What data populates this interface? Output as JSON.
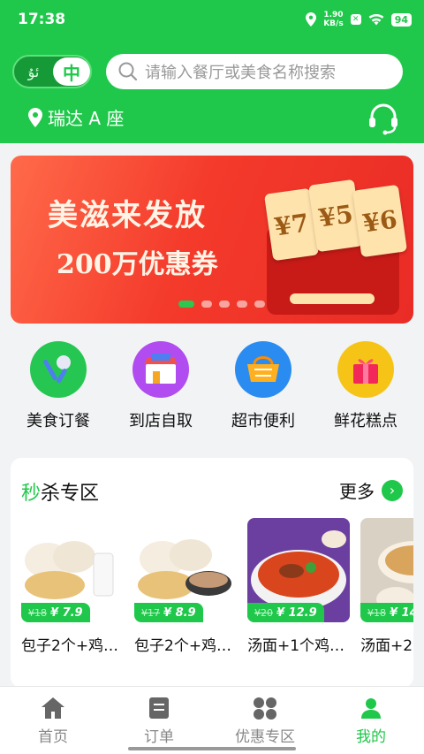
{
  "status_bar": {
    "time": "17:38",
    "speed_value": "1.90",
    "speed_unit": "KB/s",
    "battery": "94"
  },
  "header": {
    "lang_ug": "ئۇ",
    "lang_zh": "中",
    "search_placeholder": "请输入餐厅或美食名称搜索",
    "location": "瑞达 A 座"
  },
  "banner": {
    "line1": "美滋来发放",
    "line2": "200万优惠券",
    "coupons": [
      "¥7",
      "¥5",
      "¥6"
    ]
  },
  "categories": [
    {
      "label": "美食订餐",
      "icon": "food-order-icon"
    },
    {
      "label": "到店自取",
      "icon": "store-pickup-icon"
    },
    {
      "label": "超市便利",
      "icon": "supermarket-icon"
    },
    {
      "label": "鲜花糕点",
      "icon": "flower-cake-icon"
    }
  ],
  "flash_sale": {
    "title_prefix": "秒",
    "title_rest": "杀专区",
    "more": "更多",
    "items": [
      {
        "name": "包子2个+鸡…",
        "old_price": "¥18",
        "price": "¥ 7.9"
      },
      {
        "name": "包子2个+鸡…",
        "old_price": "¥17",
        "price": "¥ 8.9"
      },
      {
        "name": "汤面+1个鸡…",
        "old_price": "¥20",
        "price": "¥ 12.9"
      },
      {
        "name": "汤面+2",
        "old_price": "¥18",
        "price": "¥ 14"
      }
    ]
  },
  "tabs": [
    {
      "label": "首页",
      "icon": "home-icon"
    },
    {
      "label": "订单",
      "icon": "order-icon"
    },
    {
      "label": "优惠专区",
      "icon": "coupon-icon"
    },
    {
      "label": "我的",
      "icon": "profile-icon"
    }
  ],
  "colors": {
    "brand_green": "#1fc84a",
    "banner_red": "#f43a2b"
  }
}
